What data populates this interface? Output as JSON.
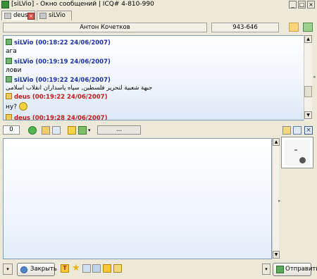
{
  "window": {
    "title": "[siLVio] - Окно сообщений | ICQ# 4-810-990",
    "minimize_label": "_",
    "maximize_label": "□",
    "close_label": "×"
  },
  "tabs": [
    {
      "label": "deus"
    },
    {
      "label": "siLVio"
    }
  ],
  "contact": {
    "name": "Антон Кочетков",
    "uin": "943-646"
  },
  "messages": [
    {
      "header": "siLVio (00:18:22 24/06/2007)",
      "text": "ага",
      "dir": "in"
    },
    {
      "header": "siLVio (00:19:19 24/06/2007)",
      "text": "лови",
      "dir": "in"
    },
    {
      "header": "siLVio (00:19:22 24/06/2007)",
      "text": "جبهة شعبية لتحرير فلسطين, سپاه پاسداران انقلاب اسلامی",
      "dir": "in"
    },
    {
      "header": "deus (00:19:22 24/06/2007)",
      "text": "ну?",
      "dir": "out",
      "smiley": true
    },
    {
      "header": "deus (00:19:28 24/06/2007)",
      "text": "",
      "dir": "out"
    }
  ],
  "toolbar": {
    "counter": "0",
    "ellipsis": "..."
  },
  "bottom": {
    "close_label": "Закрыть",
    "send_label": "Отправить"
  },
  "icons": {
    "accent": "#316ac5",
    "incoming_color": "#1a2fa6",
    "outgoing_color": "#c41a1a"
  }
}
